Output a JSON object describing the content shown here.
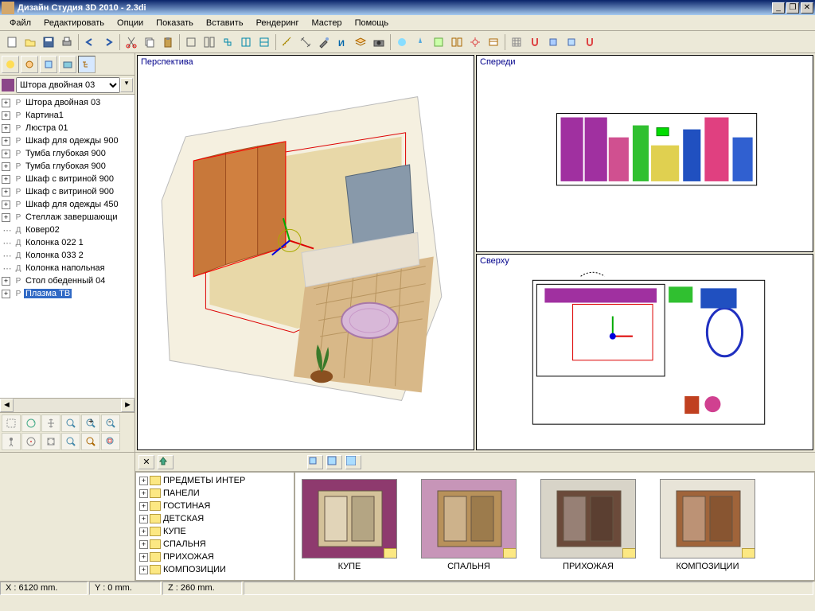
{
  "title": "Дизайн Студия 3D 2010 - 2.3di",
  "menu": [
    "Файл",
    "Редактировать",
    "Опции",
    "Показать",
    "Вставить",
    "Рендеринг",
    "Мастер",
    "Помощь"
  ],
  "object_selector": "Штора двойная 03",
  "scene_tree": [
    {
      "icon": "P",
      "label": "Штора двойная 03",
      "exp": true
    },
    {
      "icon": "P",
      "label": "Картина1",
      "exp": true
    },
    {
      "icon": "P",
      "label": "Люстра 01",
      "exp": true
    },
    {
      "icon": "P",
      "label": "Шкаф для одежды 900",
      "exp": true
    },
    {
      "icon": "P",
      "label": "Тумба глубокая 900",
      "exp": true
    },
    {
      "icon": "P",
      "label": "Тумба глубокая 900",
      "exp": true
    },
    {
      "icon": "P",
      "label": "Шкаф с витриной 900",
      "exp": true
    },
    {
      "icon": "P",
      "label": "Шкаф с витриной 900",
      "exp": true
    },
    {
      "icon": "P",
      "label": "Шкаф для одежды 450",
      "exp": true
    },
    {
      "icon": "P",
      "label": "Стеллаж завершающи",
      "exp": true
    },
    {
      "icon": "Д",
      "label": "Ковер02",
      "exp": false
    },
    {
      "icon": "Д",
      "label": "Колонка 022 1",
      "exp": false
    },
    {
      "icon": "Д",
      "label": "Колонка 033 2",
      "exp": false
    },
    {
      "icon": "Д",
      "label": "Колонка напольная",
      "exp": false
    },
    {
      "icon": "P",
      "label": "Стол обеденный 04",
      "exp": true
    },
    {
      "icon": "P",
      "label": "Плазма ТВ",
      "exp": true,
      "selected": true
    }
  ],
  "viewports": {
    "perspective": "Перспектива",
    "front": "Спереди",
    "top": "Сверху"
  },
  "categories": [
    "ПРЕДМЕТЫ ИНТЕР",
    "ПАНЕЛИ",
    "ГОСТИНАЯ",
    "ДЕТСКАЯ",
    "КУПЕ",
    "СПАЛЬНЯ",
    "ПРИХОЖАЯ",
    "КОМПОЗИЦИИ"
  ],
  "gallery": [
    "КУПЕ",
    "СПАЛЬНЯ",
    "ПРИХОЖАЯ",
    "КОМПОЗИЦИИ"
  ],
  "status": {
    "x": "X : 6120 mm.",
    "y": "Y : 0 mm.",
    "z": "Z : 260 mm."
  },
  "thumbs": {
    "0": {
      "bg": "#8e3a6e",
      "fg": "#d4c29a"
    },
    "1": {
      "bg": "#c795b8",
      "fg": "#b8915a"
    },
    "2": {
      "bg": "#d8d4c8",
      "fg": "#6b4a3a"
    },
    "3": {
      "bg": "#e8e4d8",
      "fg": "#a0643a"
    }
  }
}
